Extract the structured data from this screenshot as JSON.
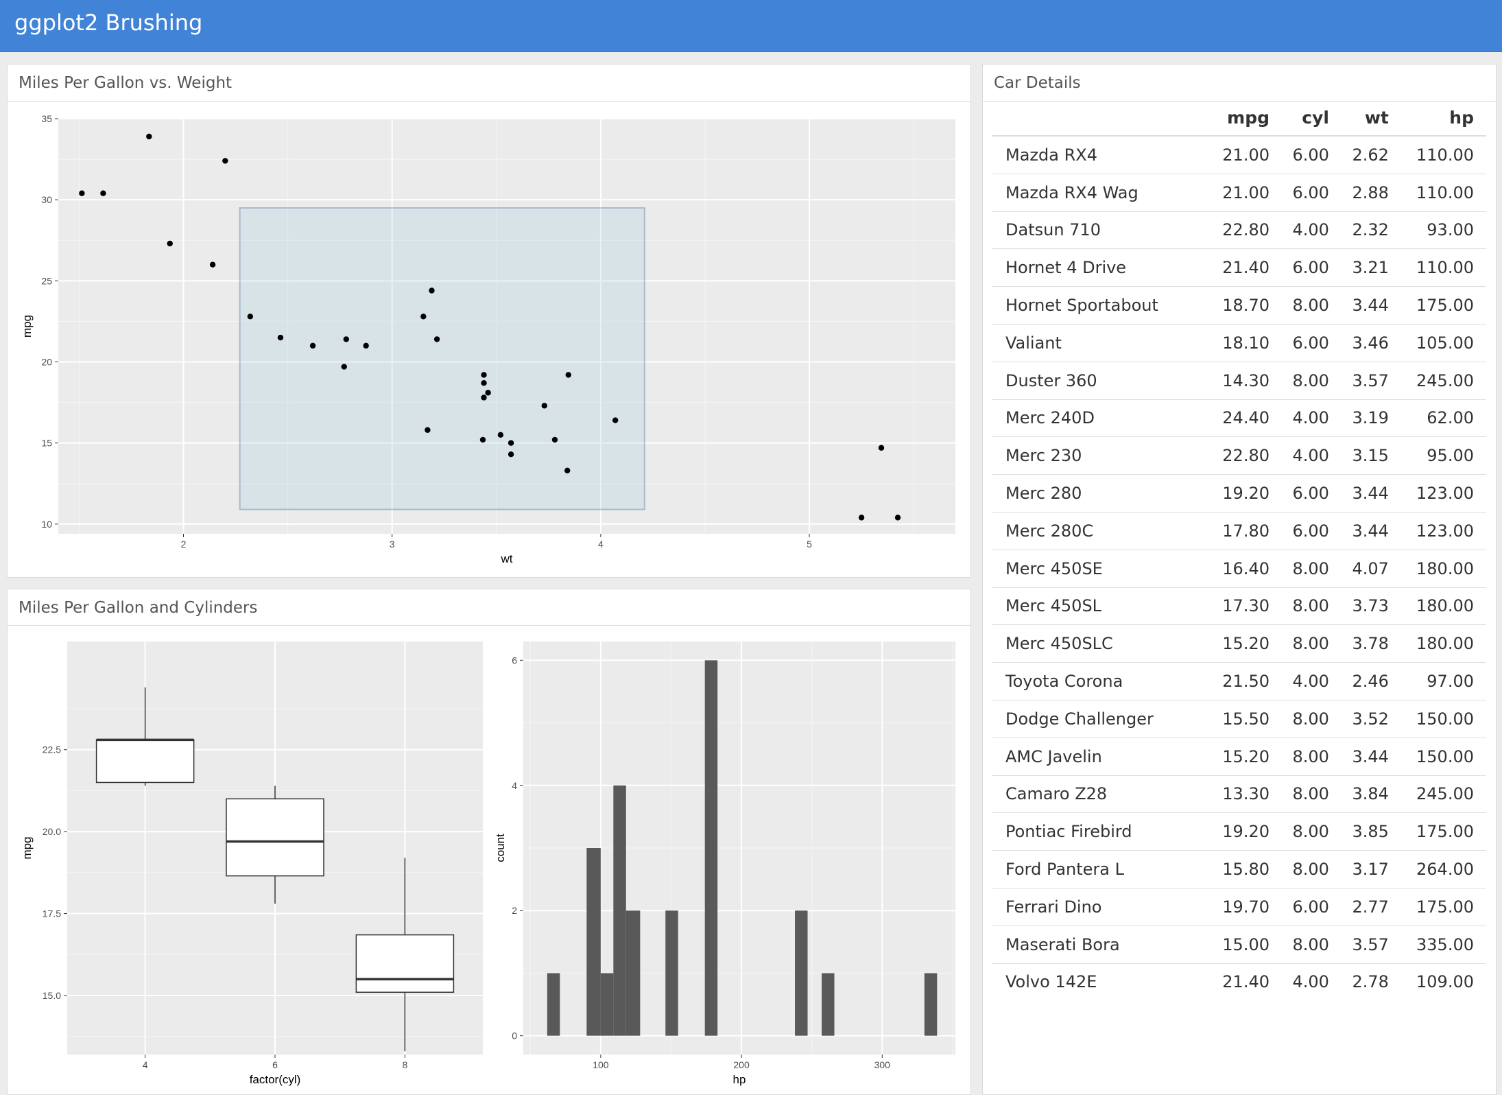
{
  "app": {
    "title": "ggplot2 Brushing"
  },
  "panels": {
    "scatter_title": "Miles Per Gallon vs. Weight",
    "bottom_title": "Miles Per Gallon and Cylinders",
    "table_title": "Car Details"
  },
  "colors": {
    "header": "#4183d7",
    "plot_bg": "#ebebeb",
    "brush_fill": "#9ecae1",
    "bar": "#595959"
  },
  "brush": {
    "xmin": 2.27,
    "xmax": 4.21,
    "ymin": 10.9,
    "ymax": 29.5
  },
  "table": {
    "columns": [
      "",
      "mpg",
      "cyl",
      "wt",
      "hp"
    ],
    "rows": [
      [
        "Mazda RX4",
        "21.00",
        "6.00",
        "2.62",
        "110.00"
      ],
      [
        "Mazda RX4 Wag",
        "21.00",
        "6.00",
        "2.88",
        "110.00"
      ],
      [
        "Datsun 710",
        "22.80",
        "4.00",
        "2.32",
        "93.00"
      ],
      [
        "Hornet 4 Drive",
        "21.40",
        "6.00",
        "3.21",
        "110.00"
      ],
      [
        "Hornet Sportabout",
        "18.70",
        "8.00",
        "3.44",
        "175.00"
      ],
      [
        "Valiant",
        "18.10",
        "6.00",
        "3.46",
        "105.00"
      ],
      [
        "Duster 360",
        "14.30",
        "8.00",
        "3.57",
        "245.00"
      ],
      [
        "Merc 240D",
        "24.40",
        "4.00",
        "3.19",
        "62.00"
      ],
      [
        "Merc 230",
        "22.80",
        "4.00",
        "3.15",
        "95.00"
      ],
      [
        "Merc 280",
        "19.20",
        "6.00",
        "3.44",
        "123.00"
      ],
      [
        "Merc 280C",
        "17.80",
        "6.00",
        "3.44",
        "123.00"
      ],
      [
        "Merc 450SE",
        "16.40",
        "8.00",
        "4.07",
        "180.00"
      ],
      [
        "Merc 450SL",
        "17.30",
        "8.00",
        "3.73",
        "180.00"
      ],
      [
        "Merc 450SLC",
        "15.20",
        "8.00",
        "3.78",
        "180.00"
      ],
      [
        "Toyota Corona",
        "21.50",
        "4.00",
        "2.46",
        "97.00"
      ],
      [
        "Dodge Challenger",
        "15.50",
        "8.00",
        "3.52",
        "150.00"
      ],
      [
        "AMC Javelin",
        "15.20",
        "8.00",
        "3.44",
        "150.00"
      ],
      [
        "Camaro Z28",
        "13.30",
        "8.00",
        "3.84",
        "245.00"
      ],
      [
        "Pontiac Firebird",
        "19.20",
        "8.00",
        "3.85",
        "175.00"
      ],
      [
        "Ford Pantera L",
        "15.80",
        "8.00",
        "3.17",
        "264.00"
      ],
      [
        "Ferrari Dino",
        "19.70",
        "6.00",
        "2.77",
        "175.00"
      ],
      [
        "Maserati Bora",
        "15.00",
        "8.00",
        "3.57",
        "335.00"
      ],
      [
        "Volvo 142E",
        "21.40",
        "4.00",
        "2.78",
        "109.00"
      ]
    ]
  },
  "chart_data": [
    {
      "type": "scatter",
      "xlabel": "wt",
      "ylabel": "mpg",
      "xlim": [
        1.4,
        5.7
      ],
      "ylim": [
        9.4,
        35.0
      ],
      "xticks": [
        2,
        3,
        4,
        5
      ],
      "yticks": [
        10,
        15,
        20,
        25,
        30,
        35
      ],
      "points": [
        [
          2.62,
          21.0
        ],
        [
          2.875,
          21.0
        ],
        [
          2.32,
          22.8
        ],
        [
          3.215,
          21.4
        ],
        [
          3.44,
          18.7
        ],
        [
          3.46,
          18.1
        ],
        [
          3.57,
          14.3
        ],
        [
          3.19,
          24.4
        ],
        [
          3.15,
          22.8
        ],
        [
          3.44,
          19.2
        ],
        [
          3.44,
          17.8
        ],
        [
          4.07,
          16.4
        ],
        [
          3.73,
          17.3
        ],
        [
          3.78,
          15.2
        ],
        [
          5.25,
          10.4
        ],
        [
          5.424,
          10.4
        ],
        [
          5.345,
          14.7
        ],
        [
          2.2,
          32.4
        ],
        [
          1.615,
          30.4
        ],
        [
          1.835,
          33.9
        ],
        [
          2.465,
          21.5
        ],
        [
          3.52,
          15.5
        ],
        [
          3.435,
          15.2
        ],
        [
          3.84,
          13.3
        ],
        [
          3.845,
          19.2
        ],
        [
          1.935,
          27.3
        ],
        [
          2.14,
          26.0
        ],
        [
          1.513,
          30.4
        ],
        [
          3.17,
          15.8
        ],
        [
          2.77,
          19.7
        ],
        [
          3.57,
          15.0
        ],
        [
          2.78,
          21.4
        ]
      ]
    },
    {
      "type": "box",
      "xlabel": "factor(cyl)",
      "ylabel": "mpg",
      "categories": [
        "4",
        "6",
        "8"
      ],
      "ylim": [
        13.2,
        25.8
      ],
      "yticks": [
        15.0,
        17.5,
        20.0,
        22.5
      ],
      "ytick_labels": [
        "15.0",
        "17.5",
        "20.0",
        "22.5"
      ],
      "boxes": [
        {
          "lower_whisker": 21.4,
          "q1": 21.5,
          "median": 22.8,
          "q3": 22.8,
          "upper_whisker": 24.4
        },
        {
          "lower_whisker": 17.8,
          "q1": 18.65,
          "median": 19.7,
          "q3": 21.0,
          "upper_whisker": 21.4
        },
        {
          "lower_whisker": 13.3,
          "q1": 15.1,
          "median": 15.5,
          "q3": 16.85,
          "upper_whisker": 19.2
        }
      ]
    },
    {
      "type": "bar",
      "subtype": "histogram",
      "xlabel": "hp",
      "ylabel": "count",
      "xlim": [
        45,
        352
      ],
      "ylim": [
        -0.3,
        6.3
      ],
      "xticks": [
        100,
        200,
        300
      ],
      "yticks": [
        0,
        2,
        4,
        6
      ],
      "bins": [
        {
          "x0": 62,
          "x1": 71,
          "count": 1
        },
        {
          "x0": 90,
          "x1": 100,
          "count": 3
        },
        {
          "x0": 100,
          "x1": 109,
          "count": 1
        },
        {
          "x0": 109,
          "x1": 118,
          "count": 4
        },
        {
          "x0": 118,
          "x1": 128,
          "count": 2
        },
        {
          "x0": 146,
          "x1": 155,
          "count": 2
        },
        {
          "x0": 174,
          "x1": 183,
          "count": 6
        },
        {
          "x0": 238,
          "x1": 247,
          "count": 2
        },
        {
          "x0": 257,
          "x1": 266,
          "count": 1
        },
        {
          "x0": 330,
          "x1": 339,
          "count": 1
        }
      ]
    }
  ]
}
